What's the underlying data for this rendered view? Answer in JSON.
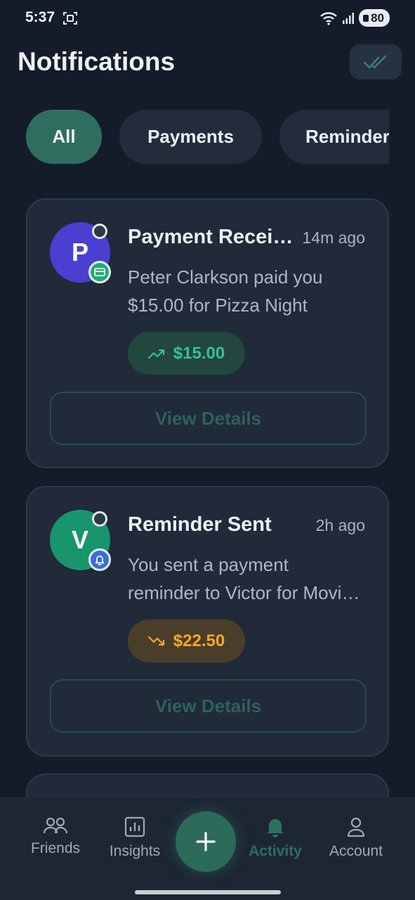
{
  "status_bar": {
    "time": "5:37",
    "battery": "80"
  },
  "header": {
    "title": "Notifications"
  },
  "filters": [
    {
      "label": "All",
      "active": true
    },
    {
      "label": "Payments",
      "active": false
    },
    {
      "label": "Reminders",
      "active": false
    }
  ],
  "notifications": [
    {
      "avatar_letter": "P",
      "avatar_color": "#4a3fd1",
      "badge": "card-icon",
      "badge_color": "#1fae72",
      "title": "Payment Received",
      "time": "14m ago",
      "message": "Peter Clarkson paid you $15.00 for Pizza Night",
      "amount": "$15.00",
      "direction": "up",
      "action_label": "View Details"
    },
    {
      "avatar_letter": "V",
      "avatar_color": "#18956c",
      "badge": "bell-icon",
      "badge_color": "#3a6ed8",
      "title": "Reminder Sent",
      "time": "2h ago",
      "message": "You sent a payment reminder to Victor for Movie Night",
      "amount": "$22.50",
      "direction": "down",
      "action_label": "View Details"
    }
  ],
  "bottom_nav": {
    "friends": "Friends",
    "insights": "Insights",
    "activity": "Activity",
    "account": "Account"
  },
  "colors": {
    "accent": "#2f6e5f",
    "positive": "#38c08e",
    "warning": "#f2a928"
  }
}
